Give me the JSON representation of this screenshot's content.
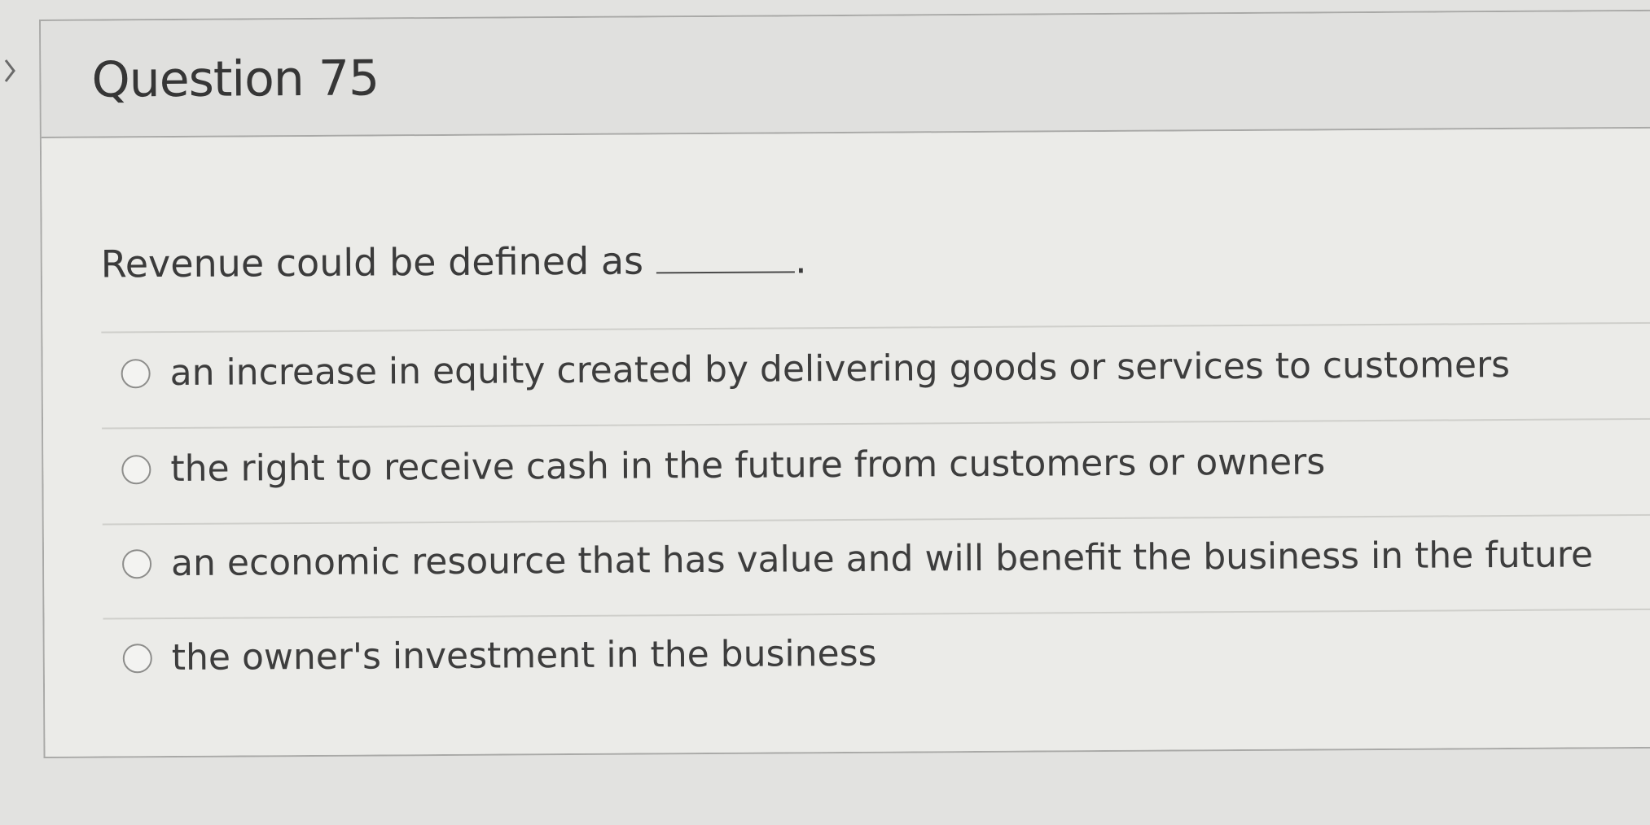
{
  "question": {
    "title": "Question 75",
    "prompt": "Revenue could be defined as",
    "prompt_end": ".",
    "options": [
      {
        "label": "an increase in equity created by delivering goods or services to customers",
        "selected": false
      },
      {
        "label": "the right to receive cash in the future from customers or owners",
        "selected": false
      },
      {
        "label": "an economic resource that has value and will benefit the business in the future",
        "selected": false
      },
      {
        "label": "the owner's investment in the business",
        "selected": false
      }
    ]
  },
  "icons": {
    "collapse": "chevron-right-icon",
    "radio": "radio-unselected-icon"
  },
  "colors": {
    "background": "#e2e2e0",
    "card_border": "#a9a9a7",
    "text": "#3d3d3d"
  }
}
